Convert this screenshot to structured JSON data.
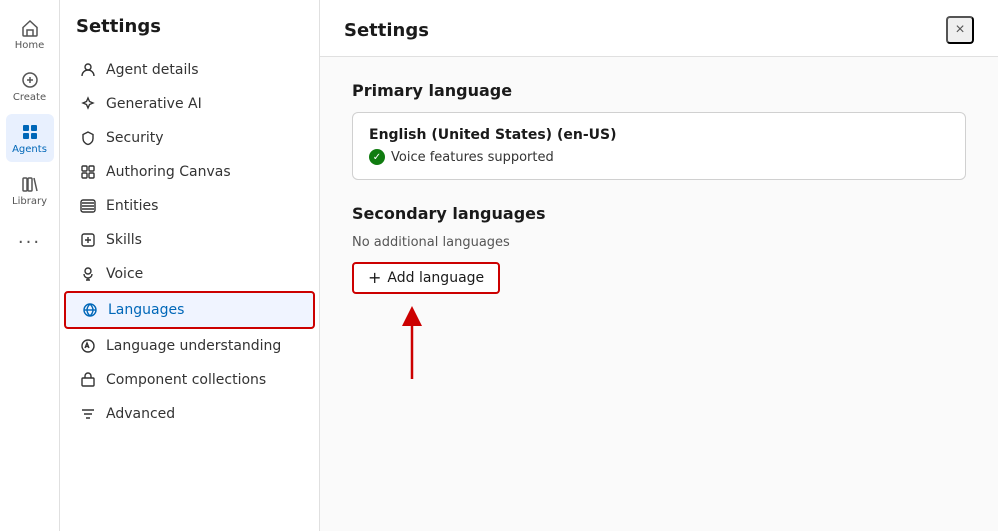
{
  "nav": {
    "items": [
      {
        "id": "home",
        "label": "Home",
        "active": false
      },
      {
        "id": "create",
        "label": "Create",
        "active": false
      },
      {
        "id": "agents",
        "label": "Agents",
        "active": true
      },
      {
        "id": "library",
        "label": "Library",
        "active": false
      },
      {
        "id": "more",
        "label": "...",
        "active": false
      }
    ]
  },
  "sidebar": {
    "title": "Settings",
    "items": [
      {
        "id": "agent-details",
        "label": "Agent details"
      },
      {
        "id": "generative-ai",
        "label": "Generative AI"
      },
      {
        "id": "security",
        "label": "Security"
      },
      {
        "id": "authoring-canvas",
        "label": "Authoring Canvas"
      },
      {
        "id": "entities",
        "label": "Entities"
      },
      {
        "id": "skills",
        "label": "Skills"
      },
      {
        "id": "voice",
        "label": "Voice"
      },
      {
        "id": "languages",
        "label": "Languages",
        "active": true
      },
      {
        "id": "language-understanding",
        "label": "Language understanding"
      },
      {
        "id": "component-collections",
        "label": "Component collections"
      },
      {
        "id": "advanced",
        "label": "Advanced"
      }
    ]
  },
  "main": {
    "title": "Settings",
    "close_label": "×",
    "primary_language": {
      "section_title": "Primary language",
      "lang_name": "English (United States) (en-US)",
      "voice_label": "Voice features supported"
    },
    "secondary_languages": {
      "section_title": "Secondary languages",
      "no_additional": "No additional languages",
      "add_button_label": "Add language"
    }
  }
}
